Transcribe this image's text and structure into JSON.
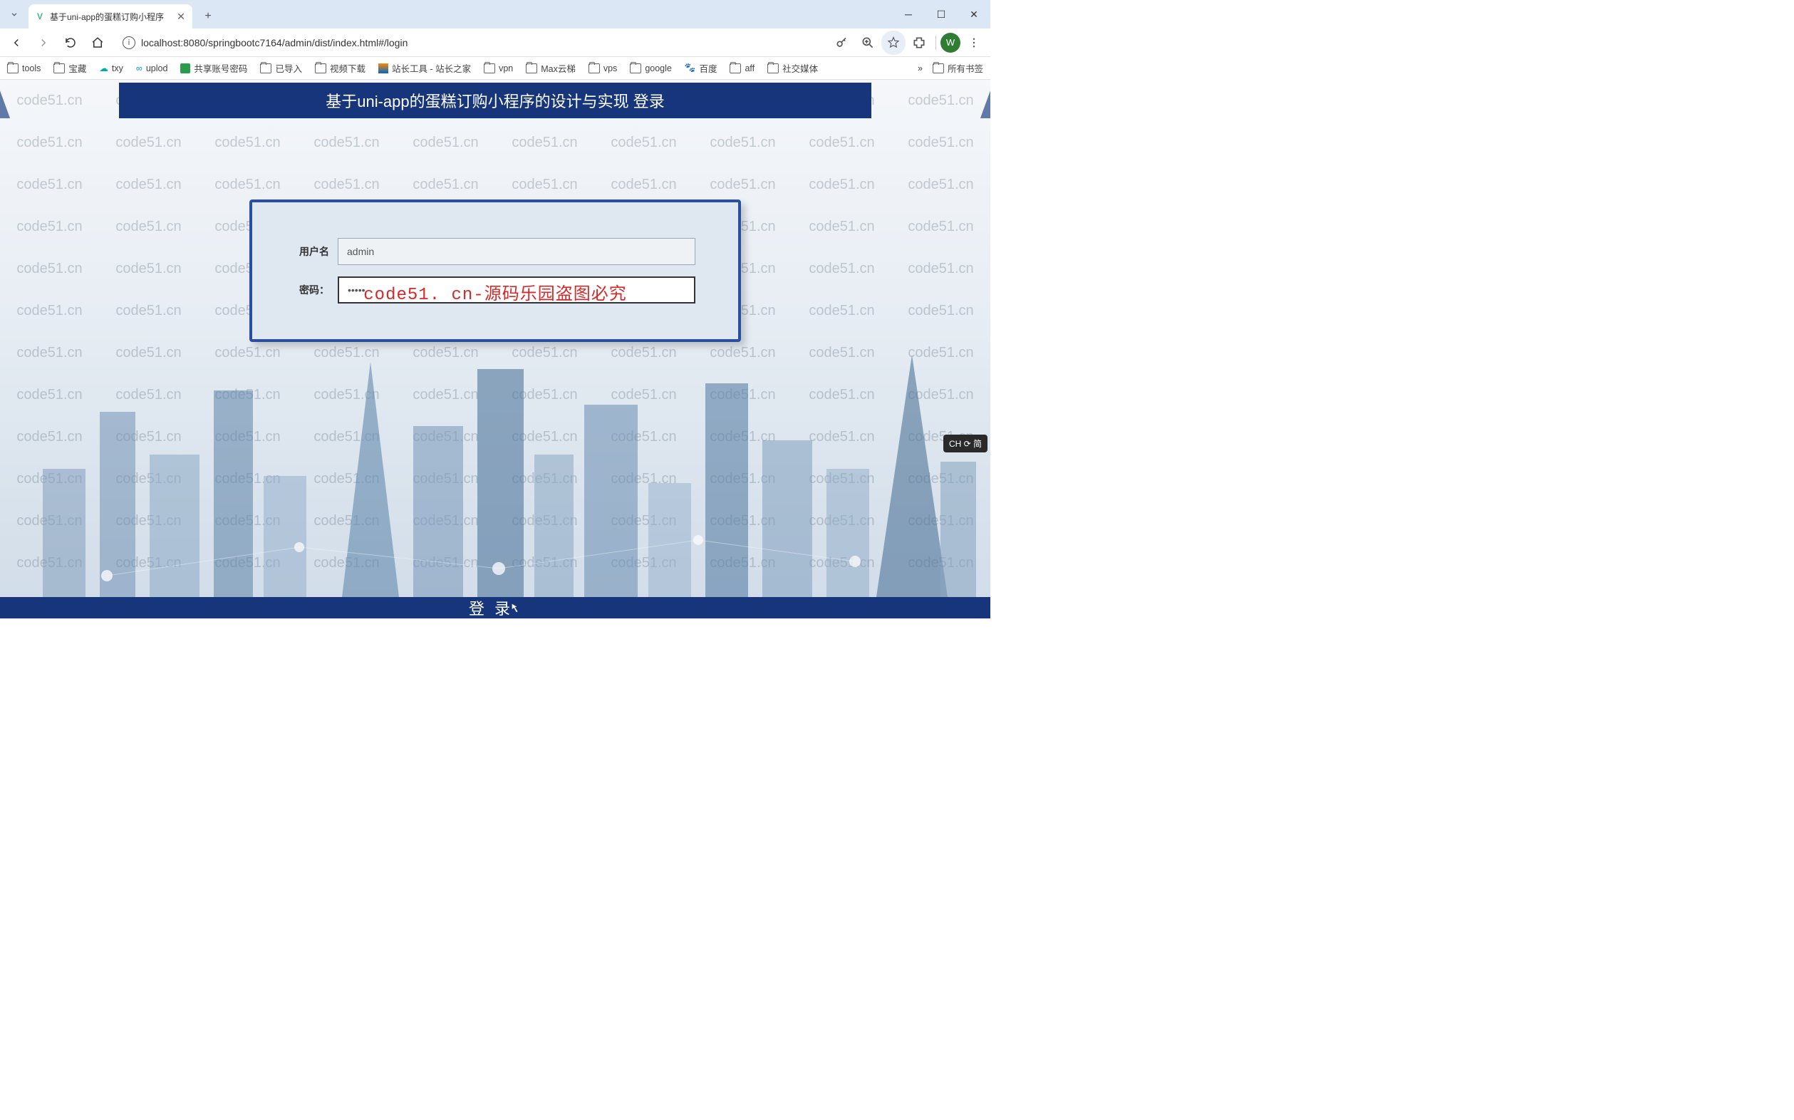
{
  "browser": {
    "tab_title": "基于uni-app的蛋糕订购小程序",
    "url": "localhost:8080/springbootc7164/admin/dist/index.html#/login",
    "avatar_letter": "W"
  },
  "bookmarks": {
    "items": [
      "tools",
      "宝藏",
      "txy",
      "uplod",
      "共享账号密码",
      "已导入",
      "视频下载",
      "站长工具 - 站长之家",
      "vpn",
      "Max云梯",
      "vps",
      "google",
      "百度",
      "aff",
      "社交媒体"
    ],
    "all": "所有书签"
  },
  "page": {
    "header_title": "基于uni-app的蛋糕订购小程序的设计与实现 登录",
    "username_label": "用户名",
    "password_label": "密码：",
    "username_value": "admin",
    "password_value": "•••••",
    "login_button": "登 录",
    "watermark_text": "code51.cn",
    "overlay_text": "code51. cn-源码乐园盗图必究",
    "ime_badge": "CH ⟳ 简"
  }
}
